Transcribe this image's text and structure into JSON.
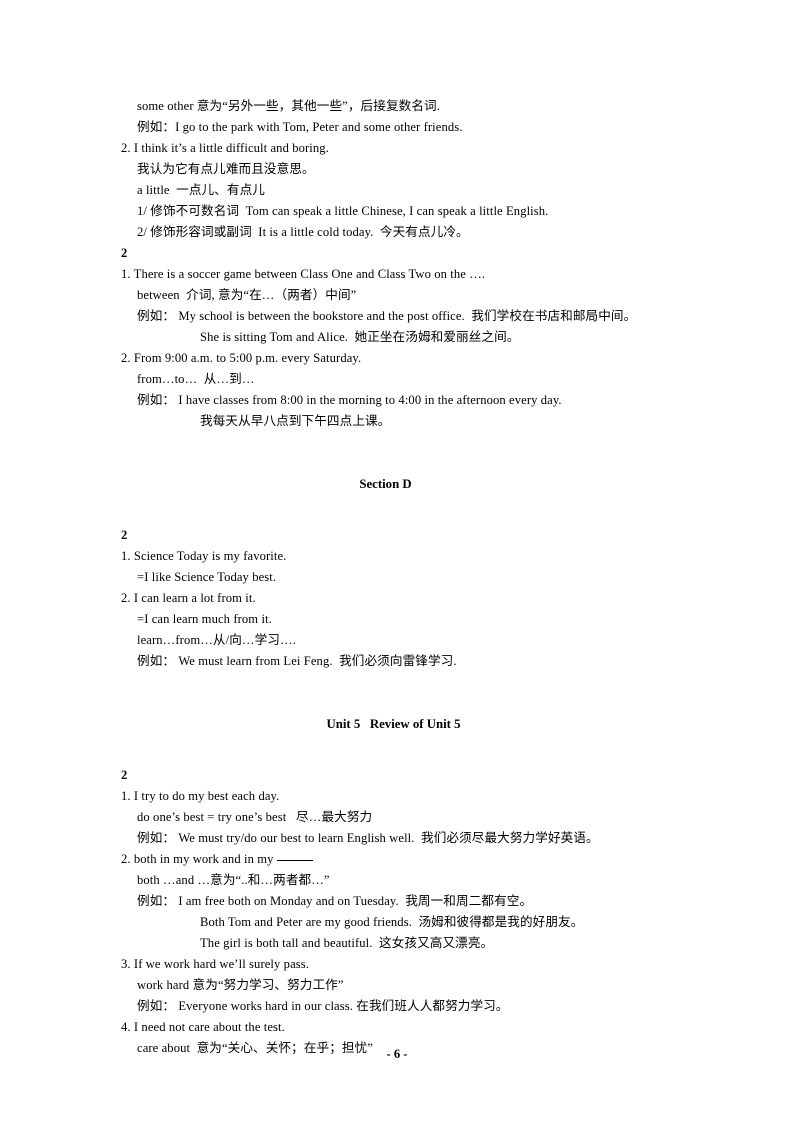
{
  "document": {
    "page_number_label": "- 6 -",
    "blocks": [
      {
        "kind": "line",
        "indent": 1,
        "text": "some other 意为“另外一些，其他一些”，后接复数名词."
      },
      {
        "kind": "line",
        "indent": 1,
        "text": "例如：I go to the park with Tom, Peter and some other friends."
      },
      {
        "kind": "line",
        "indent": 0,
        "text": "2. I think it’s a little difficult and boring."
      },
      {
        "kind": "line",
        "indent": 1,
        "text": "我认为它有点儿难而且没意思。"
      },
      {
        "kind": "line",
        "indent": 1,
        "text": "a little  一点儿、有点儿"
      },
      {
        "kind": "line",
        "indent": 1,
        "text": "1/ 修饰不可数名词  Tom can speak a little Chinese, I can speak a little English."
      },
      {
        "kind": "line",
        "indent": 1,
        "text": "2/ 修饰形容词或副词  It is a little cold today.  今天有点儿冷。"
      },
      {
        "kind": "secnum",
        "indent": 0,
        "text": "2"
      },
      {
        "kind": "line",
        "indent": 0,
        "text": "1. There is a soccer game between Class One and Class Two on the …."
      },
      {
        "kind": "line",
        "indent": 1,
        "text": "between  介词, 意为“在…（两者）中间”"
      },
      {
        "kind": "line",
        "indent": 1,
        "text": "例如： My school is between the bookstore and the post office.  我们学校在书店和邮局中间。"
      },
      {
        "kind": "line",
        "indent": 3,
        "text": "She is sitting Tom and Alice.  她正坐在汤姆和爱丽丝之间。"
      },
      {
        "kind": "line",
        "indent": 0,
        "text": "2. From 9:00 a.m. to 5:00 p.m. every Saturday."
      },
      {
        "kind": "line",
        "indent": 1,
        "text": "from…to…  从…到…"
      },
      {
        "kind": "line",
        "indent": 1,
        "text": "例如： I have classes from 8:00 in the morning to 4:00 in the afternoon every day."
      },
      {
        "kind": "line",
        "indent": 3,
        "text": "我每天从早八点到下午四点上课。"
      },
      {
        "kind": "spacer",
        "size": "lg"
      },
      {
        "kind": "heading",
        "variant": "hd-d",
        "text": "Section D"
      },
      {
        "kind": "spacer",
        "size": "md"
      },
      {
        "kind": "secnum",
        "indent": 0,
        "text": "2"
      },
      {
        "kind": "line",
        "indent": 0,
        "text": "1. Science Today is my favorite."
      },
      {
        "kind": "line",
        "indent": 1,
        "text": "=I like Science Today best."
      },
      {
        "kind": "line",
        "indent": 0,
        "text": "2. I can learn a lot from it."
      },
      {
        "kind": "line",
        "indent": 1,
        "text": "=I can learn much from it."
      },
      {
        "kind": "line",
        "indent": 1,
        "text": "learn…from…从/向…学习…."
      },
      {
        "kind": "line",
        "indent": 1,
        "text": "例如： We must learn from Lei Feng.  我们必须向雷锋学习."
      },
      {
        "kind": "spacer",
        "size": "lg"
      },
      {
        "kind": "heading",
        "variant": "hd-u5",
        "text": "Unit 5   Review of Unit 5"
      },
      {
        "kind": "spacer",
        "size": "md"
      },
      {
        "kind": "secnum",
        "indent": 0,
        "text": "2"
      },
      {
        "kind": "line",
        "indent": 0,
        "text": "1. I try to do my best each day."
      },
      {
        "kind": "line",
        "indent": 1,
        "text": "do one’s best = try one’s best   尽…最大努力"
      },
      {
        "kind": "line",
        "indent": 1,
        "text": "例如： We must try/do our best to learn English well.  我们必须尽最大努力学好英语。"
      },
      {
        "kind": "line_blank",
        "indent": 0,
        "text_before": "2. both in my work and in my ",
        "text_after": ""
      },
      {
        "kind": "line",
        "indent": 1,
        "text": "both …and …意为“..和…两者都…”"
      },
      {
        "kind": "line",
        "indent": 1,
        "text": "例如： I am free both on Monday and on Tuesday.  我周一和周二都有空。"
      },
      {
        "kind": "line",
        "indent": 3,
        "text": "Both Tom and Peter are my good friends.  汤姆和彼得都是我的好朋友。"
      },
      {
        "kind": "line",
        "indent": 3,
        "text": "The girl is both tall and beautiful.  这女孩又高又漂亮。"
      },
      {
        "kind": "line",
        "indent": 0,
        "text": "3. If we work hard we’ll surely pass."
      },
      {
        "kind": "line",
        "indent": 1,
        "text": "work hard 意为“努力学习、努力工作”"
      },
      {
        "kind": "line",
        "indent": 1,
        "text": "例如： Everyone works hard in our class. 在我们班人人都努力学习。"
      },
      {
        "kind": "line",
        "indent": 0,
        "text": "4. I need not care about the test."
      },
      {
        "kind": "line",
        "indent": 1,
        "text": "care about  意为“关心、关怀；在乎；担忧”"
      }
    ]
  }
}
